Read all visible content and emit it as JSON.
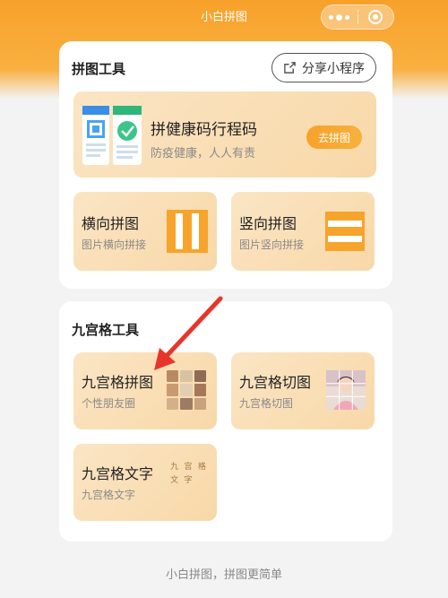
{
  "header": {
    "title": "小白拼图"
  },
  "sections": {
    "tools_title": "拼图工具",
    "nine_title": "九宫格工具"
  },
  "share_button": {
    "label": "分享小程序"
  },
  "health_tile": {
    "title": "拼健康码行程码",
    "subtitle": "防疫健康，人人有责",
    "button": "去拼图"
  },
  "horizontal_tile": {
    "title": "横向拼图",
    "subtitle": "图片横向拼接"
  },
  "vertical_tile": {
    "title": "竖向拼图",
    "subtitle": "图片竖向拼接"
  },
  "nine_collage_tile": {
    "title": "九宫格拼图",
    "subtitle": "个性朋友圈"
  },
  "nine_cut_tile": {
    "title": "九宫格切图",
    "subtitle": "九宫格切图"
  },
  "nine_text_tile": {
    "title": "九宫格文字",
    "subtitle": "九宫格文字",
    "grid_chars": [
      "九",
      "宫",
      "格",
      "文",
      "字",
      "",
      "",
      "",
      ""
    ]
  },
  "footer": {
    "text": "小白拼图，拼图更简单"
  },
  "colors": {
    "accent": "#f7a12a",
    "tile": "#fbe5c4",
    "arrow": "#e8352b"
  },
  "icons": [
    "more-dots-icon",
    "target-icon",
    "share-icon",
    "horizontal-collage-icon",
    "vertical-collage-icon"
  ]
}
